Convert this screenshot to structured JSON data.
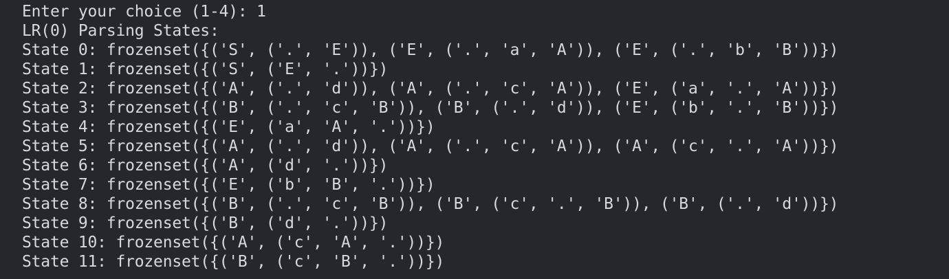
{
  "terminal": {
    "lines": [
      "Enter your choice (1-4): 1",
      "LR(0) Parsing States:",
      "State 0: frozenset({('S', ('.', 'E')), ('E', ('.', 'a', 'A')), ('E', ('.', 'b', 'B'))})",
      "State 1: frozenset({('S', ('E', '.'))})",
      "State 2: frozenset({('A', ('.', 'd')), ('A', ('.', 'c', 'A')), ('E', ('a', '.', 'A'))})",
      "State 3: frozenset({('B', ('.', 'c', 'B')), ('B', ('.', 'd')), ('E', ('b', '.', 'B'))})",
      "State 4: frozenset({('E', ('a', 'A', '.'))})",
      "State 5: frozenset({('A', ('.', 'd')), ('A', ('.', 'c', 'A')), ('A', ('c', '.', 'A'))})",
      "State 6: frozenset({('A', ('d', '.'))})",
      "State 7: frozenset({('E', ('b', 'B', '.'))})",
      "State 8: frozenset({('B', ('.', 'c', 'B')), ('B', ('c', '.', 'B')), ('B', ('.', 'd'))})",
      "State 9: frozenset({('B', ('d', '.'))})",
      "State 10: frozenset({('A', ('c', 'A', '.'))})",
      "State 11: frozenset({('B', ('c', 'B', '.'))})"
    ]
  }
}
